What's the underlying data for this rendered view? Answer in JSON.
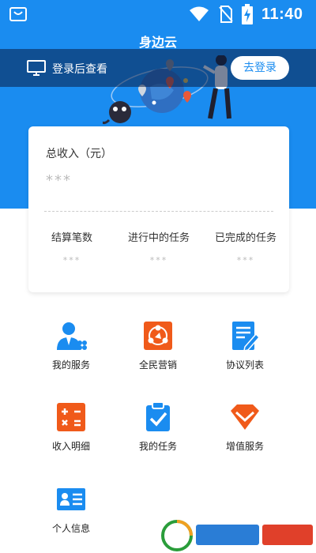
{
  "status_bar": {
    "time": "11:40",
    "icons": [
      "shopping-bag-icon",
      "wifi-icon",
      "no-sim-icon",
      "battery-charging-icon"
    ]
  },
  "header": {
    "title": "身边云",
    "login_prompt": "登录后查看",
    "login_button": "去登录"
  },
  "income_card": {
    "total_label": "总收入（元）",
    "total_value": "***",
    "stats": [
      {
        "label": "结算笔数",
        "value": "***"
      },
      {
        "label": "进行中的任务",
        "value": "***"
      },
      {
        "label": "已完成的任务",
        "value": "***"
      }
    ]
  },
  "menu": [
    {
      "label": "我的服务",
      "icon": "user-service-icon"
    },
    {
      "label": "全民营销",
      "icon": "marketing-icon"
    },
    {
      "label": "协议列表",
      "icon": "agreement-icon"
    },
    {
      "label": "收入明细",
      "icon": "calculator-icon"
    },
    {
      "label": "我的任务",
      "icon": "task-clipboard-icon"
    },
    {
      "label": "增值服务",
      "icon": "diamond-icon"
    },
    {
      "label": "个人信息",
      "icon": "id-card-icon"
    }
  ],
  "colors": {
    "brand_blue": "#1a8cf0",
    "orange": "#f05a1a",
    "text": "#222222",
    "muted": "#bbbbbb"
  }
}
